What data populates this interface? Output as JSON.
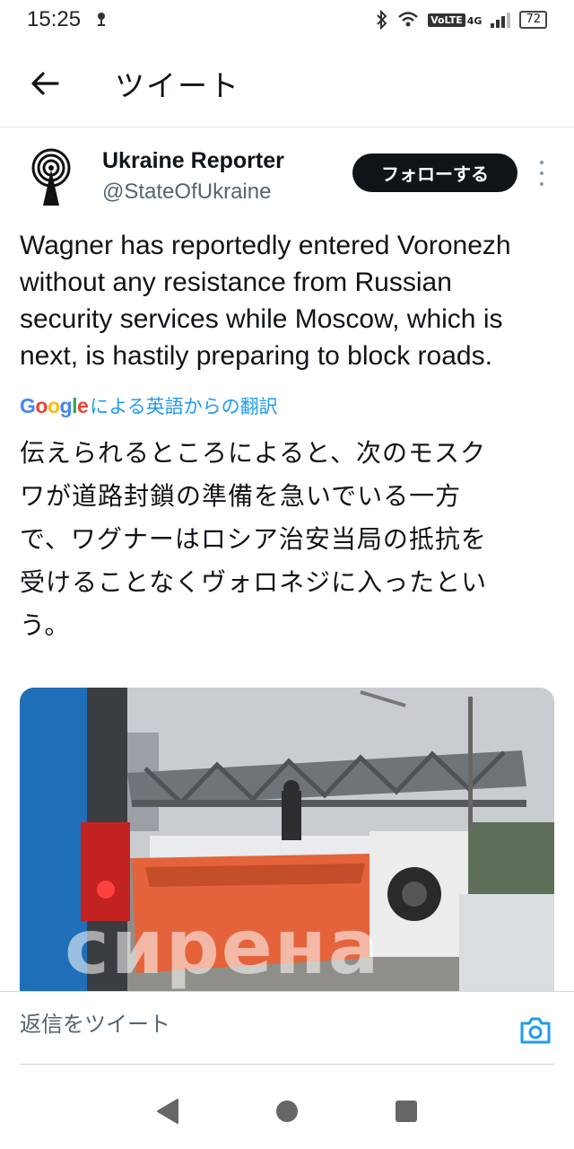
{
  "status_bar": {
    "time": "15:25",
    "network_label": "VoLTE",
    "network_type": "4G",
    "battery": "72"
  },
  "header": {
    "title": "ツイート",
    "back_icon": "arrow-left-icon"
  },
  "tweet": {
    "display_name": "Ukraine Reporter",
    "handle": "@StateOfUkraine",
    "follow_label": "フォローする",
    "text": "Wagner has reportedly entered Voronezh\nwithout any resistance from Russian\nsecurity services while Moscow, which is\nnext, is hastily preparing to block roads.",
    "translation_provider": "Google",
    "translation_label": "による英語からの翻訳",
    "translated_text": "伝えられるところによると、次のモスク\nワが道路封鎖の準備を急いでいる一方\nで、ワグナーはロシア治安当局の抵抗を\n受けることなくヴォロネジに入ったとい\nう。",
    "media_watermark": "сирена"
  },
  "reply": {
    "placeholder": "返信をツイート",
    "camera_icon": "camera-icon"
  },
  "colors": {
    "accent": "#1d9bf0",
    "follow_bg": "#0f1419",
    "secondary_text": "#536471"
  }
}
